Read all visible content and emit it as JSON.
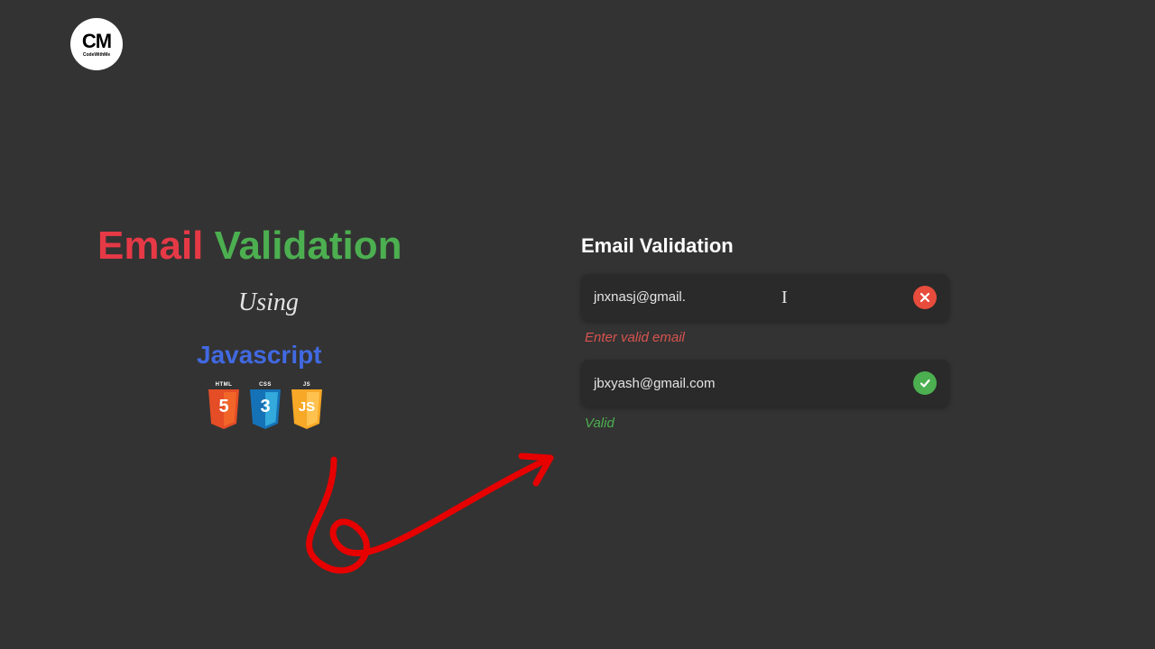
{
  "logo": {
    "text": "CM",
    "subtext": "CodeWithMe"
  },
  "headline": {
    "word1": "Email",
    "word2": "Validation"
  },
  "subtitle_using": "Using",
  "subtitle_js": "Javascript",
  "tech": {
    "html": {
      "label": "HTML",
      "badge": "5"
    },
    "css": {
      "label": "CSS",
      "badge": "3"
    },
    "js": {
      "label": "JS",
      "badge": "JS"
    }
  },
  "demo": {
    "title": "Email Validation",
    "fields": [
      {
        "value": "jnxnasj@gmail.",
        "status": "error",
        "message": "Enter valid email"
      },
      {
        "value": "jbxyash@gmail.com",
        "status": "success",
        "message": "Valid"
      }
    ]
  },
  "colors": {
    "bg": "#333333",
    "red": "#e63946",
    "green": "#4caf50",
    "blue": "#4169e1",
    "html_shield": "#e44d26",
    "css_shield": "#1572b6",
    "js_shield": "#f7a826",
    "error_icon": "#e74c3c",
    "success_icon": "#4caf50"
  }
}
